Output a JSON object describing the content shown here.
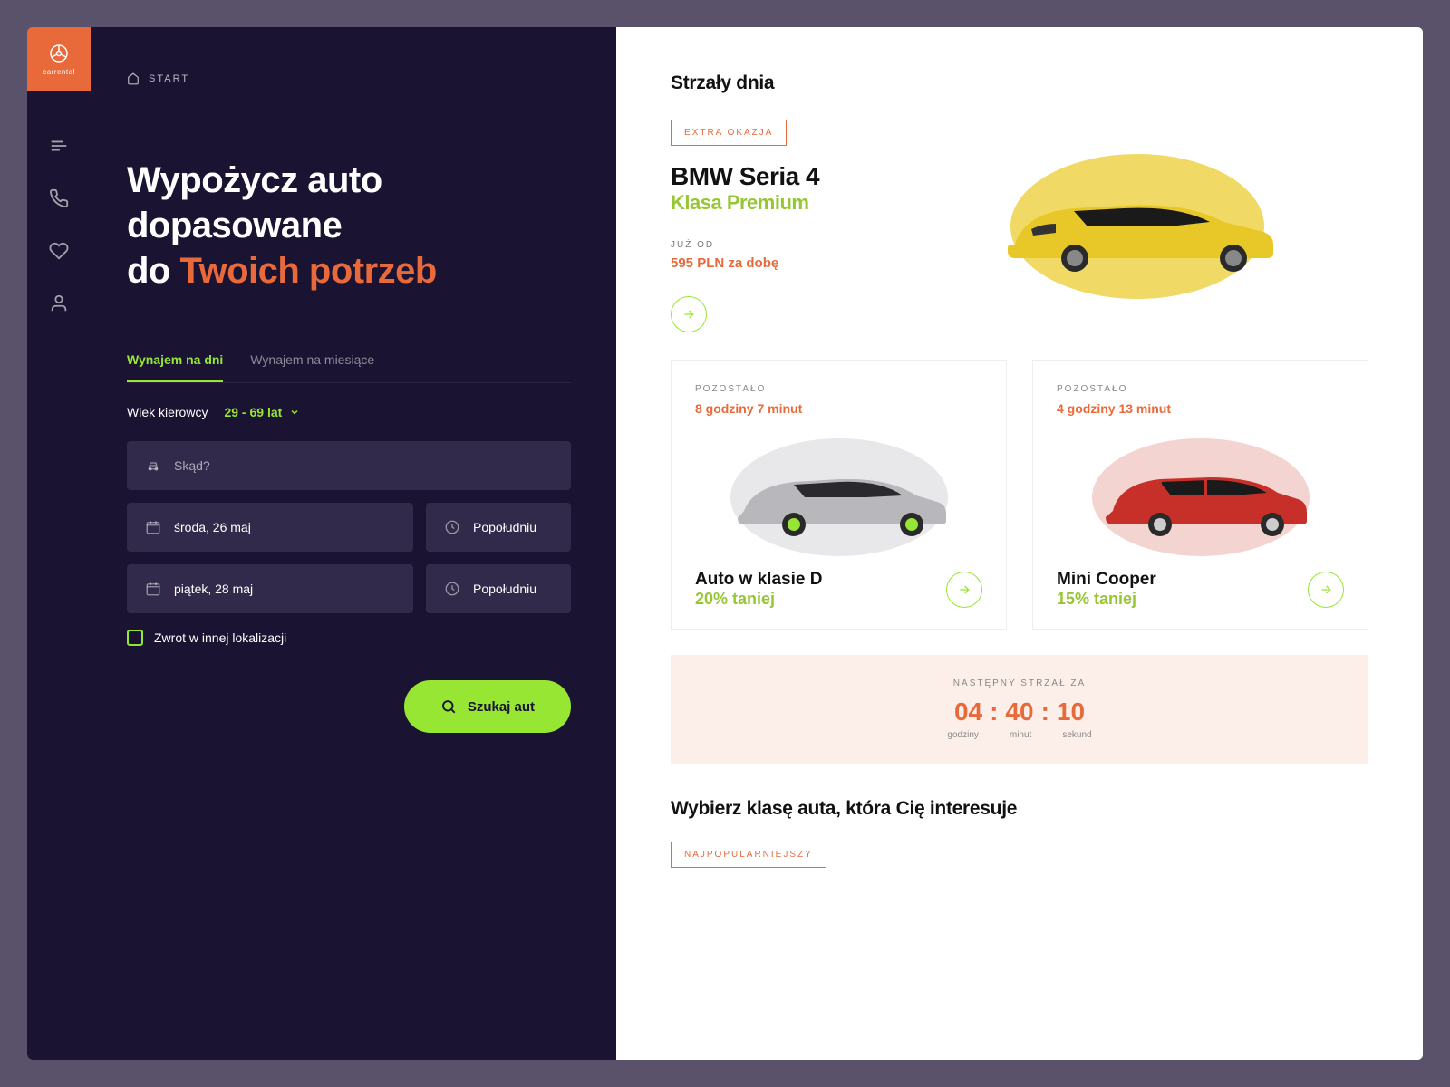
{
  "brand": {
    "name": "carrental"
  },
  "breadcrumb": {
    "start": "START"
  },
  "headline": {
    "line1": "Wypożycz auto",
    "line2": "dopasowane",
    "line3_prefix": "do ",
    "line3_accent": "Twoich potrzeb"
  },
  "tabs": {
    "days": "Wynajem na dni",
    "months": "Wynajem na miesiące"
  },
  "driver_age": {
    "label": "Wiek kierowcy",
    "value": "29 - 69 lat"
  },
  "form": {
    "from_placeholder": "Skąd?",
    "pickup_date": "środa, 26 maj",
    "pickup_time": "Popołudniu",
    "return_date": "piątek, 28 maj",
    "return_time": "Popołudniu",
    "return_elsewhere": "Zwrot w innej lokalizacji",
    "search_button": "Szukaj aut"
  },
  "deals": {
    "section_title": "Strzały dnia",
    "featured": {
      "badge": "EXTRA OKAZJA",
      "name": "BMW Seria 4",
      "class": "Klasa Premium",
      "price_label": "JUŻ OD",
      "price": "595 PLN za dobę"
    },
    "cards": [
      {
        "remain_label": "POZOSTAŁO",
        "remain_time": "8 godziny 7 minut",
        "title": "Auto w klasie D",
        "discount": "20% taniej"
      },
      {
        "remain_label": "POZOSTAŁO",
        "remain_time": "4 godziny 13 minut",
        "title": "Mini Cooper",
        "discount": "15% taniej"
      }
    ],
    "countdown": {
      "label": "NASTĘPNY STRZAŁ ZA",
      "hours": "04",
      "minutes": "40",
      "seconds": "10",
      "u_hours": "godziny",
      "u_minutes": "minut",
      "u_seconds": "sekund"
    }
  },
  "next_section": {
    "title": "Wybierz klasę auta, która Cię interesuje",
    "filter": "NAJPOPULARNIEJSZY"
  },
  "colors": {
    "accent": "#e86a3a",
    "lime": "#97e633"
  }
}
